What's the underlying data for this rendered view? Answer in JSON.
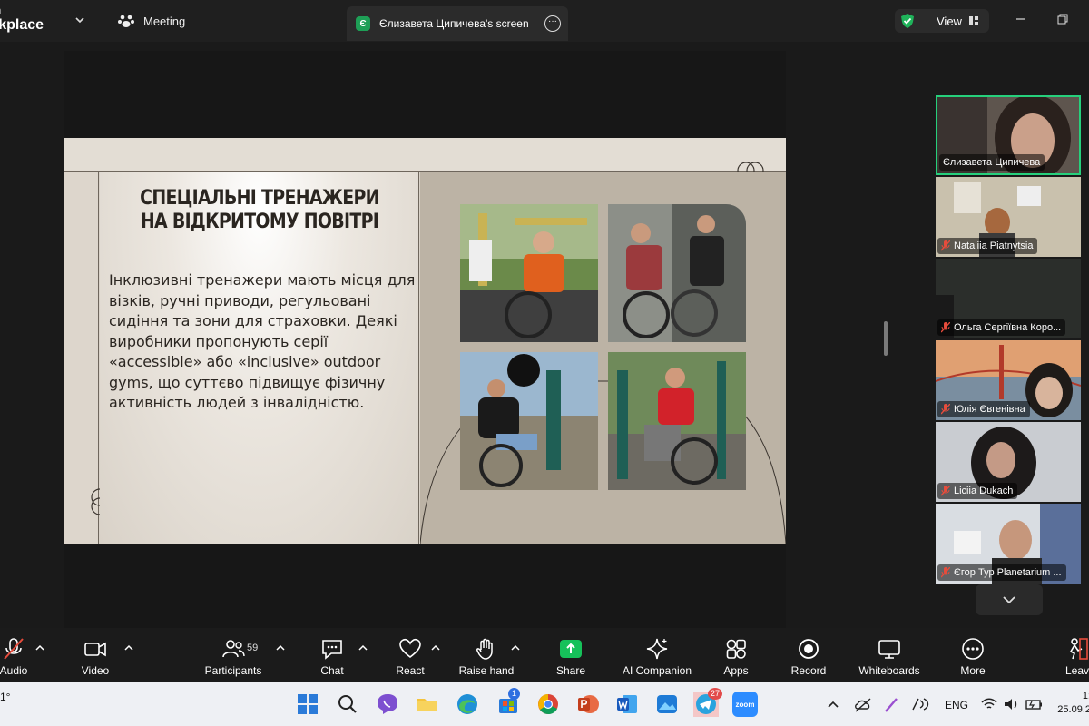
{
  "app": {
    "title_line1": "m",
    "title_line2": "rkplace"
  },
  "header": {
    "meeting_label": "Meeting",
    "screen_tab_badge": "Є",
    "screen_tab_label": "Єлизавета Ципичева's screen",
    "view_label": "View"
  },
  "slide": {
    "title": "СПЕЦІАЛЬНІ ТРЕНАЖЕРИ НА ВІДКРИТОМУ ПОВІТРІ",
    "body": "Інклюзивні тренажери мають місця для візків, ручні приводи, регульовані сидіння та зони для страховки. Деякі виробники пропонують серії «accessible» або «inclusive» outdoor gyms, що суттєво підвищує фізичну активність людей з інвалідністю."
  },
  "participants": [
    {
      "name": "Єлизавета Ципичева",
      "muted": false,
      "active": true
    },
    {
      "name": "Nataliia Piatnytsia",
      "muted": true,
      "active": false
    },
    {
      "name": "Ольга Сергіївна Коро...",
      "muted": true,
      "active": false
    },
    {
      "name": "Юлія Євгенівна",
      "muted": true,
      "active": false
    },
    {
      "name": "Liciia Dukach",
      "muted": true,
      "active": false
    },
    {
      "name": "Єгор Тур Planetarium ...",
      "muted": true,
      "active": false
    }
  ],
  "toolbar": {
    "audio_label": "Audio",
    "video_label": "Video",
    "participants_label": "Participants",
    "participants_count": "59",
    "chat_label": "Chat",
    "react_label": "React",
    "raise_hand_label": "Raise hand",
    "share_label": "Share",
    "ai_label": "AI Companion",
    "apps_label": "Apps",
    "record_label": "Record",
    "whiteboards_label": "Whiteboards",
    "more_label": "More",
    "leave_label": "Leav"
  },
  "taskbar": {
    "weather_temp": "1°",
    "store_badge": "1",
    "telegram_badge": "27",
    "zoom_label": "zoom",
    "language": "ENG",
    "time": "1:",
    "date": "25.09.2"
  },
  "colors": {
    "accent_green": "#26d07c",
    "share_green": "#16c15a",
    "slide_bg": "#d9d2c8"
  }
}
